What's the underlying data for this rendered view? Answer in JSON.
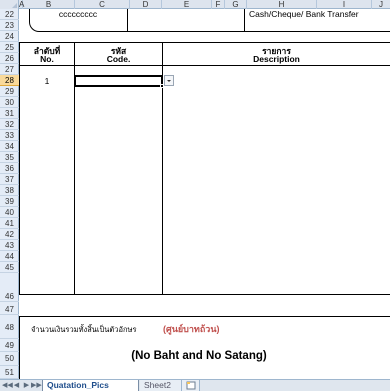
{
  "columns": [
    "A",
    "B",
    "C",
    "D",
    "E",
    "F",
    "G",
    "H",
    "I",
    "J"
  ],
  "rows": [
    "22",
    "23",
    "24",
    "25",
    "26",
    "27",
    "28",
    "29",
    "30",
    "31",
    "32",
    "33",
    "34",
    "35",
    "36",
    "37",
    "38",
    "39",
    "40",
    "41",
    "42",
    "43",
    "44",
    "45",
    "46",
    "47",
    "48",
    "49",
    "50",
    "51"
  ],
  "selected_row": "28",
  "cells": {
    "c_placeholder": "ccccccccc",
    "payment_method": "Cash/Cheque/ Bank Transfer",
    "no_th": "ลำดับที่",
    "no_en": "No.",
    "code_th": "รหัส",
    "code_en": "Code.",
    "desc_th": "รายการ",
    "desc_en": "Description",
    "item_no": "1",
    "total_words_label": "จำนวนเงินรวมทั้งสิ้นเป็นตัวอักษร",
    "total_words_value_th": "(ศูนย์บาทถ้วน)",
    "total_words_value_en": "(No Baht and No Satang)"
  },
  "dropdown_icon": "chevron-down-icon",
  "sheet_tabs": {
    "nav": [
      "◀◀",
      "◀",
      "▶",
      "▶▶"
    ],
    "tabs": [
      "Quatation_Pics",
      "Sheet2"
    ],
    "active": "Quatation_Pics",
    "new_sheet_icon": "new-sheet-icon"
  },
  "colors": {
    "header_bg": "#dde4ee",
    "selected_row_bg": "#f9d99a",
    "accent_red": "#c0504d",
    "tab_text": "#1f4e8c"
  }
}
